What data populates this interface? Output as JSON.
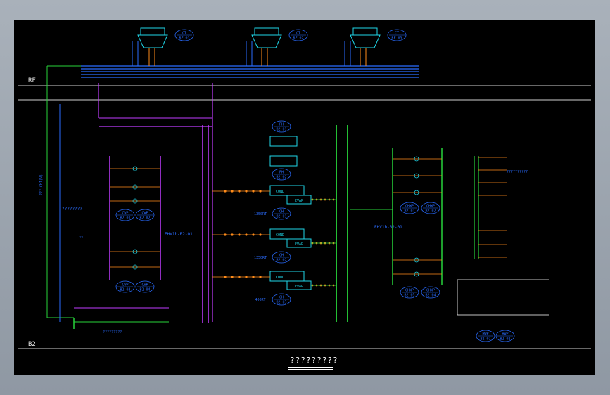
{
  "drawing": {
    "title": "?????????",
    "levels": {
      "roof": "RF",
      "basement": "B2"
    },
    "cooling_towers": [
      {
        "tag_line1": "CT",
        "tag_line2": "RF 01"
      },
      {
        "tag_line1": "CT",
        "tag_line2": "RF 02"
      },
      {
        "tag_line1": "CT",
        "tag_line2": "RF 03"
      }
    ],
    "chillers": [
      {
        "tag_line1": "CH",
        "tag_line2": "B2 01",
        "capacity": "1350RT"
      },
      {
        "tag_line1": "CH",
        "tag_line2": "B2 02",
        "capacity": "1350RT"
      },
      {
        "tag_line1": "CH",
        "tag_line2": "B2 03",
        "capacity": "400RT"
      }
    ],
    "plate_exchangers": [
      {
        "tag_line1": "PH",
        "tag_line2": "B2 01"
      },
      {
        "tag_line1": "PH",
        "tag_line2": "B2 02"
      }
    ],
    "pumps_left": [
      {
        "tag_line1": "CWP",
        "tag_line2": "B2 01"
      },
      {
        "tag_line1": "CWP",
        "tag_line2": "B2 02"
      },
      {
        "tag_line1": "CWP",
        "tag_line2": "B2 03"
      },
      {
        "tag_line1": "CWP",
        "tag_line2": "B2 04"
      }
    ],
    "pumps_right": [
      {
        "tag_line1": "CHWP",
        "tag_line2": "B2 01"
      },
      {
        "tag_line1": "CHWP",
        "tag_line2": "B2 02"
      },
      {
        "tag_line1": "CHWP",
        "tag_line2": "B2 03"
      },
      {
        "tag_line1": "CHWP",
        "tag_line2": "B2 04"
      }
    ],
    "small_pumps": [
      {
        "tag_line1": "HWP",
        "tag_line2": "B2 01"
      },
      {
        "tag_line1": "HWP",
        "tag_line2": "B2 02"
      }
    ],
    "labels": {
      "evap": "EVAP",
      "cond": "COND",
      "ehv_left": "EHV1b-B2-01",
      "ehv_right": "EHV1b-B2-01",
      "pipe_main": "??? CHI(V)",
      "q_marks": "????????",
      "unit": "??",
      "note_right": "??????????",
      "note_bottom": "?????????"
    }
  }
}
